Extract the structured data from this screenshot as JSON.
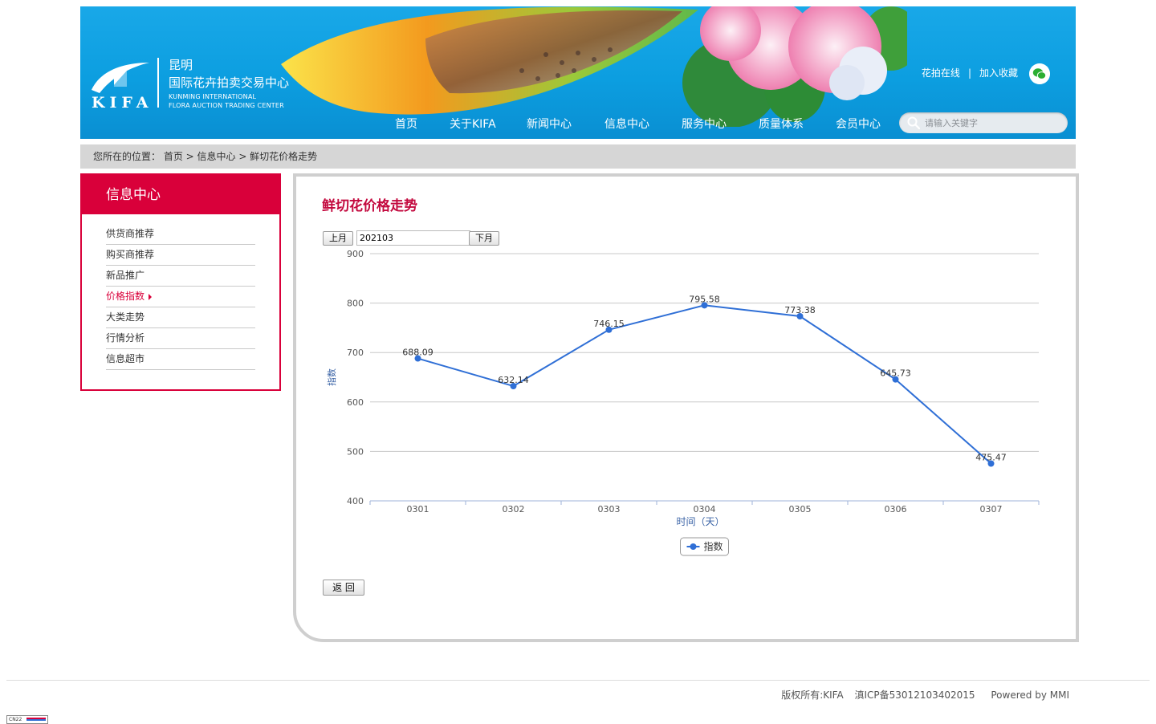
{
  "header": {
    "logo_cn_line1": "昆明",
    "logo_cn_line2": "国际花卉拍卖交易中心",
    "logo_en_line1": "KUNMING INTERNATIONAL",
    "logo_en_line2": "FLORA AUCTION TRADING CENTER",
    "logo_wordmark": "KIFA",
    "top_links": [
      "花拍在线",
      "加入收藏"
    ],
    "top_link_sep": "|",
    "nav": [
      "首页",
      "关于KIFA",
      "新闻中心",
      "信息中心",
      "服务中心",
      "质量体系",
      "会员中心"
    ],
    "search_placeholder": "请输入关键字",
    "icons": {
      "search": "search-icon",
      "wechat": "wechat-icon"
    }
  },
  "breadcrumb": "您所在的位置： 首页 > 信息中心 > 鲜切花价格走势",
  "sidebar": {
    "title": "信息中心",
    "items": [
      "供货商推荐",
      "购买商推荐",
      "新品推广",
      "价格指数",
      "大类走势",
      "行情分析",
      "信息超市"
    ],
    "active_index": 3
  },
  "content": {
    "title": "鲜切花价格走势",
    "prev_label": "上月",
    "next_label": "下月",
    "month_value": "202103",
    "back_label": "返 回"
  },
  "chart_data": {
    "type": "line",
    "categories": [
      "0301",
      "0302",
      "0303",
      "0304",
      "0305",
      "0306",
      "0307"
    ],
    "series": [
      {
        "name": "指数",
        "values": [
          688.09,
          632.14,
          746.15,
          795.58,
          773.38,
          645.73,
          475.47
        ]
      }
    ],
    "data_labels": [
      "688.09",
      "632.14",
      "746.15",
      "795.58",
      "773.38",
      "645.73",
      "475.47"
    ],
    "xlabel": "时间（天）",
    "ylabel": "指数",
    "ylim": [
      400,
      900
    ],
    "yticks": [
      "400",
      "500",
      "600",
      "700",
      "800",
      "900"
    ],
    "grid": true,
    "legend": "bottom-center",
    "color": "#2f6fd6"
  },
  "footer": {
    "copyright": "版权所有:KIFA",
    "icp": "滇ICP备53012103402015",
    "powered": "Powered by MMI",
    "badge": "CN22"
  },
  "colors": {
    "brand_red": "#d9003a",
    "header_blue": "#0fa0e2",
    "line_blue": "#2f6fd6"
  }
}
